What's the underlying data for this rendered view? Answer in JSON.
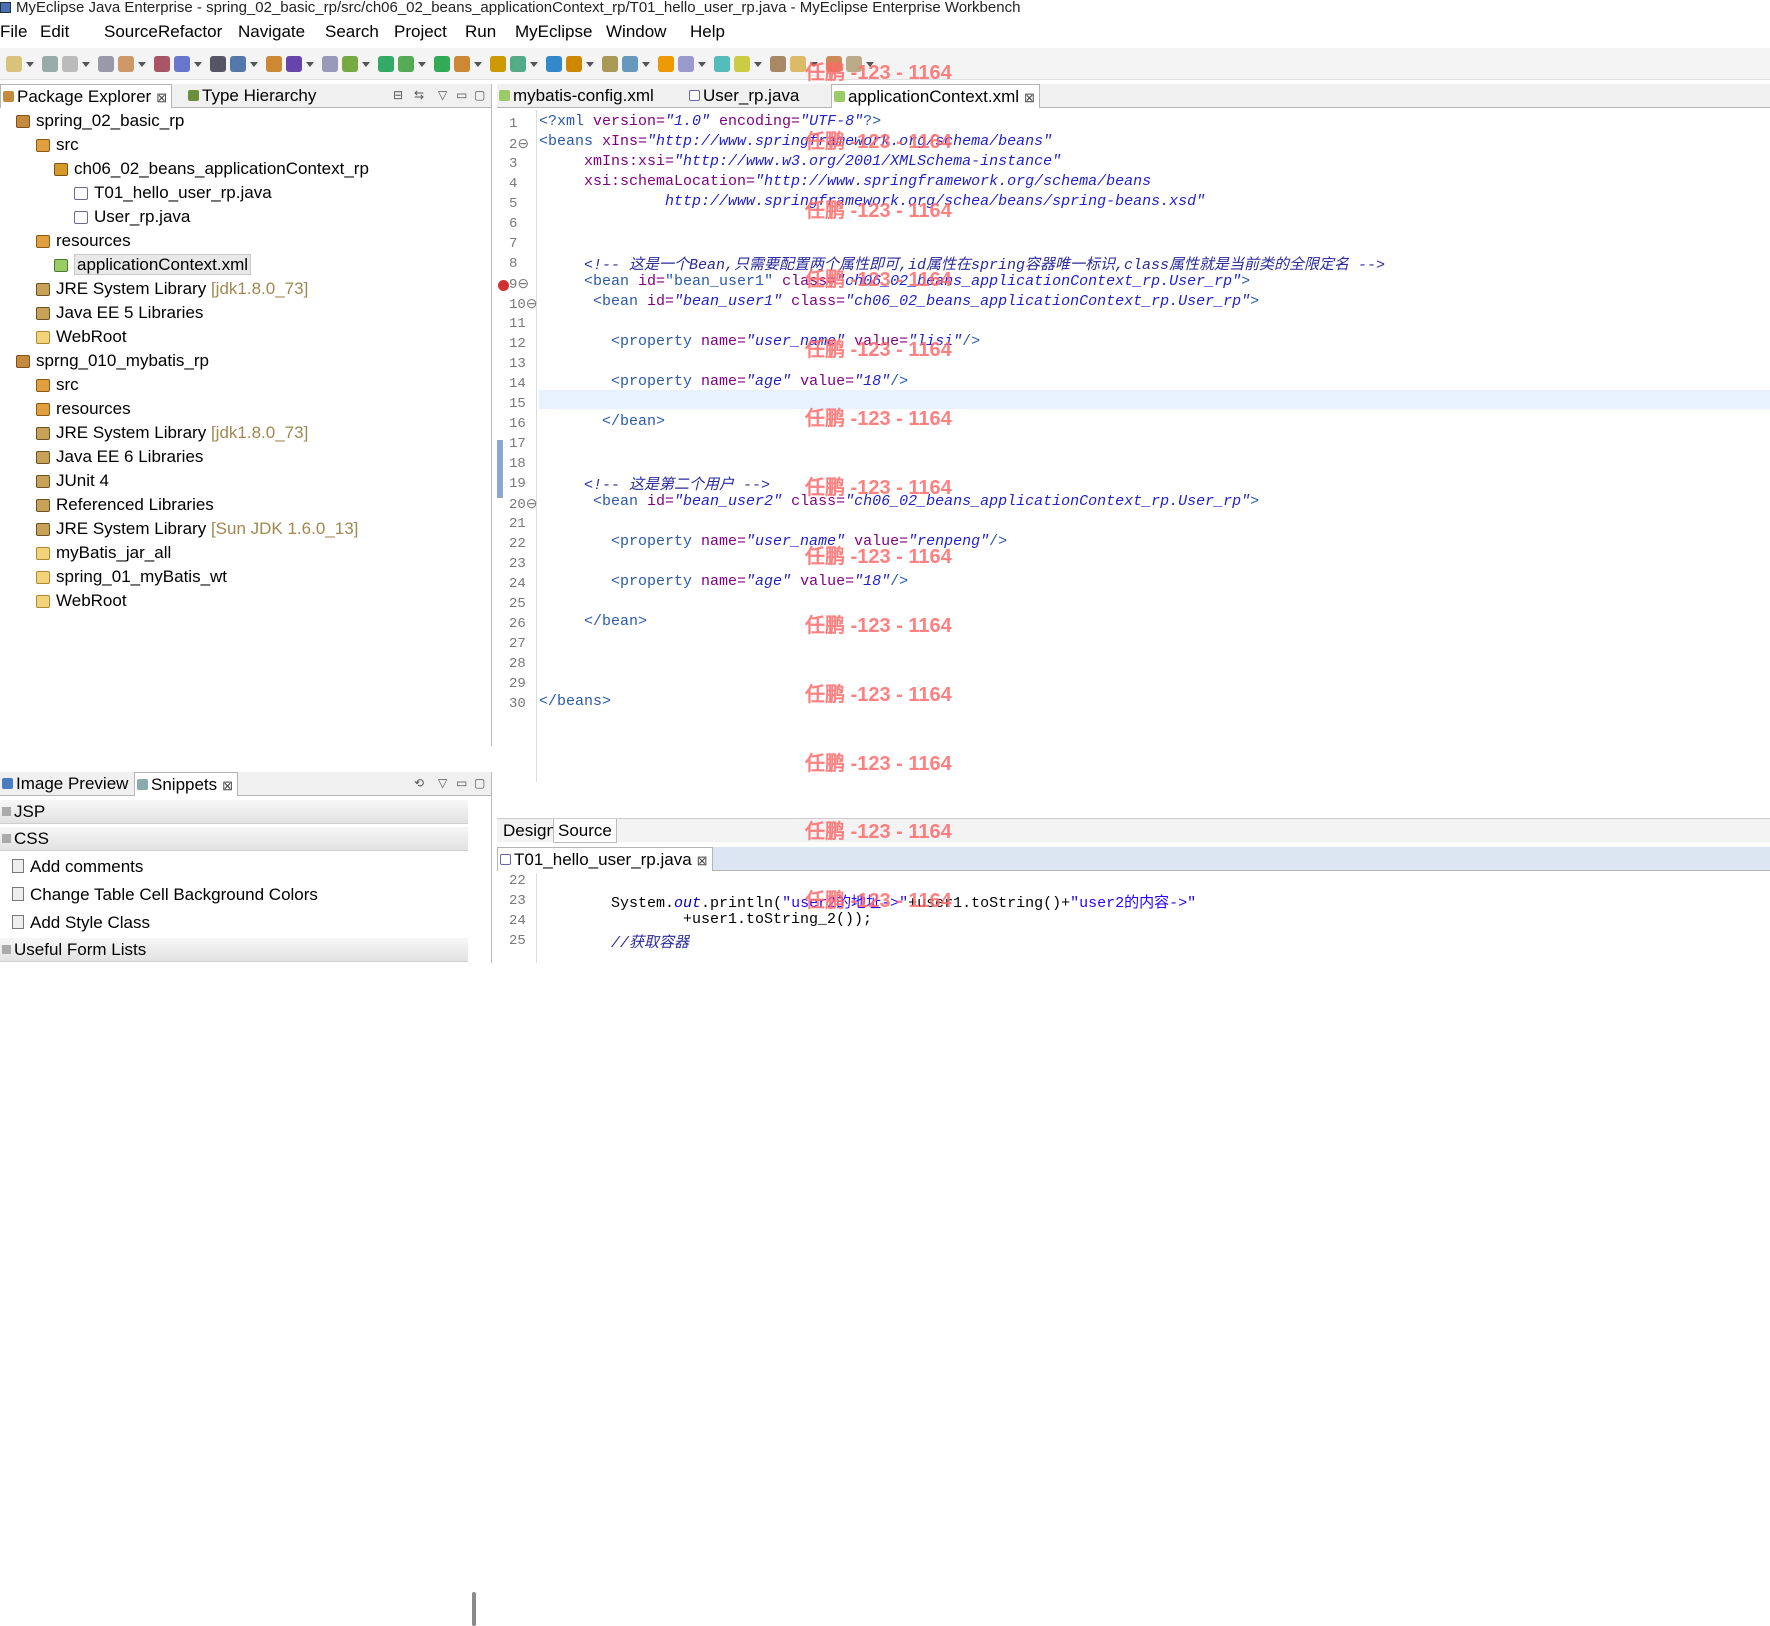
{
  "window": {
    "title": "MyEclipse Java Enterprise - spring_02_basic_rp/src/ch06_02_beans_applicationContext_rp/T01_hello_user_rp.java - MyEclipse Enterprise Workbench"
  },
  "menu": [
    "File",
    "Edit",
    "Source",
    "Refactor",
    "Navigate",
    "Search",
    "Project",
    "Run",
    "MyEclipse",
    "Window",
    "Help"
  ],
  "left_panel": {
    "tabs": [
      {
        "label": "Package Explorer"
      },
      {
        "label": "Type Hierarchy"
      }
    ],
    "close_glyph": "⊠",
    "tree": [
      {
        "label": "spring_02_basic_rp",
        "icon": "project-icon"
      },
      {
        "label": "src",
        "icon": "source-folder-icon"
      },
      {
        "label": "ch06_02_beans_applicationContext_rp",
        "icon": "package-icon"
      },
      {
        "label": "T01_hello_user_rp.java",
        "icon": "java-file-icon"
      },
      {
        "label": "User_rp.java",
        "icon": "java-file-icon"
      },
      {
        "label": "resources",
        "icon": "source-folder-icon"
      },
      {
        "label": "applicationContext.xml",
        "icon": "xml-file-icon"
      },
      {
        "label": "JRE System Library",
        "extra": "[jdk1.8.0_73]",
        "icon": "library-icon"
      },
      {
        "label": "Java EE 5 Libraries",
        "icon": "library-icon"
      },
      {
        "label": "WebRoot",
        "icon": "folder-icon"
      },
      {
        "label": "sprng_010_mybatis_rp",
        "icon": "project-icon"
      },
      {
        "label": "src",
        "icon": "source-folder-icon"
      },
      {
        "label": "resources",
        "icon": "source-folder-icon"
      },
      {
        "label": "JRE System Library",
        "extra": "[jdk1.8.0_73]",
        "icon": "library-icon"
      },
      {
        "label": "Java EE 6 Libraries",
        "icon": "library-icon"
      },
      {
        "label": "JUnit 4",
        "icon": "library-icon"
      },
      {
        "label": "Referenced Libraries",
        "icon": "library-icon"
      },
      {
        "label": "JRE System Library",
        "extra": "[Sun JDK 1.6.0_13]",
        "icon": "library-icon"
      },
      {
        "label": "myBatis_jar_all",
        "icon": "folder-icon"
      },
      {
        "label": "spring_01_myBatis_wt",
        "icon": "folder-icon"
      },
      {
        "label": "WebRoot",
        "icon": "folder-icon"
      }
    ]
  },
  "snippets_panel": {
    "tabs": [
      {
        "label": "Image Preview"
      },
      {
        "label": "Snippets"
      }
    ],
    "categories": [
      "JSP",
      "CSS",
      "Useful Form Lists"
    ],
    "items": [
      "Add comments",
      "Change Table Cell Background Colors",
      "Add Style Class"
    ]
  },
  "editor": {
    "tabs": [
      {
        "label": "mybatis-config.xml"
      },
      {
        "label": "User_rp.java"
      },
      {
        "label": "applicationContext.xml"
      }
    ],
    "line_numbers": [
      "1",
      "2⊖",
      "3",
      "4",
      "5",
      "6",
      "7",
      "8",
      "9⊖",
      "10⊖",
      "11",
      "12",
      "13",
      "14",
      "15",
      "16",
      "17",
      "18",
      "19",
      "20⊖",
      "21",
      "22",
      "23",
      "24",
      "25",
      "26",
      "27",
      "28",
      "29",
      "30"
    ],
    "lines": [
      [
        {
          "t": "<?xml ",
          "c": "tag"
        },
        {
          "t": "version=",
          "c": "attr"
        },
        {
          "t": "\"1.0\"",
          "c": "val"
        },
        {
          "t": " encoding=",
          "c": "attr"
        },
        {
          "t": "\"UTF-8\"",
          "c": "val"
        },
        {
          "t": "?>",
          "c": "tag"
        }
      ],
      [
        {
          "t": "<beans ",
          "c": "tag"
        },
        {
          "t": "xIns=",
          "c": "attr"
        },
        {
          "t": "\"http://www.springframework.org/schema/beans\"",
          "c": "val"
        }
      ],
      [
        {
          "t": "     xmIns:xsi=",
          "c": "attr"
        },
        {
          "t": "\"http://www.w3.org/2001/XMLSchema-instance\"",
          "c": "val"
        }
      ],
      [
        {
          "t": "     xsi:schemaLocation=",
          "c": "attr"
        },
        {
          "t": "\"http://www.springframework.org/schema/beans",
          "c": "val"
        }
      ],
      [
        {
          "t": "              http://www.springframework.org/schea/beans/spring-beans.xsd\"",
          "c": "val"
        }
      ],
      [],
      [],
      [
        {
          "t": "     <!-- 这是一个Bean,只需要配置两个属性即可,id属性在spring容器唯一标识,class属性就是当前类的全限定名 -->",
          "c": "cmt"
        }
      ],
      [
        {
          "t": "     <bean ",
          "c": "tag"
        },
        {
          "t": "id=",
          "c": "attr"
        },
        {
          "t": "\"bean_user1\"",
          "c": "tag"
        },
        {
          "t": " class=",
          "c": "attr"
        },
        {
          "t": "\"ch06_02_beans_applicationContext_rp.User_rp\"",
          "c": "val"
        },
        {
          "t": ">",
          "c": "tag"
        }
      ],
      [
        {
          "t": "      <bean ",
          "c": "tag"
        },
        {
          "t": "id=",
          "c": "attr"
        },
        {
          "t": "\"bean_user1\"",
          "c": "val"
        },
        {
          "t": " class=",
          "c": "attr"
        },
        {
          "t": "\"ch06_02_beans_applicationContext_rp.User_rp\"",
          "c": "val"
        },
        {
          "t": ">",
          "c": "tag"
        }
      ],
      [],
      [
        {
          "t": "        <property ",
          "c": "tag"
        },
        {
          "t": "name=",
          "c": "attr"
        },
        {
          "t": "\"user_name\"",
          "c": "val"
        },
        {
          "t": " value=",
          "c": "attr"
        },
        {
          "t": "\"lisi\"",
          "c": "val"
        },
        {
          "t": "/>",
          "c": "tag"
        }
      ],
      [],
      [
        {
          "t": "        <property ",
          "c": "tag"
        },
        {
          "t": "name=",
          "c": "attr"
        },
        {
          "t": "\"age\"",
          "c": "val"
        },
        {
          "t": " value=",
          "c": "attr"
        },
        {
          "t": "\"18\"",
          "c": "val"
        },
        {
          "t": "/>",
          "c": "tag"
        }
      ],
      [],
      [
        {
          "t": "       </bean>",
          "c": "tag"
        }
      ],
      [],
      [],
      [
        {
          "t": "     <!-- 这是第二个用户 -->",
          "c": "cmt"
        }
      ],
      [
        {
          "t": "      <bean ",
          "c": "tag"
        },
        {
          "t": "id=",
          "c": "attr"
        },
        {
          "t": "\"bean_user2\"",
          "c": "val"
        },
        {
          "t": " class=",
          "c": "attr"
        },
        {
          "t": "\"ch06_02_beans_applicationContext_rp.User_rp\"",
          "c": "val"
        },
        {
          "t": ">",
          "c": "tag"
        }
      ],
      [],
      [
        {
          "t": "        <property ",
          "c": "tag"
        },
        {
          "t": "name=",
          "c": "attr"
        },
        {
          "t": "\"user_name\"",
          "c": "val"
        },
        {
          "t": " value=",
          "c": "attr"
        },
        {
          "t": "\"renpeng\"",
          "c": "val"
        },
        {
          "t": "/>",
          "c": "tag"
        }
      ],
      [],
      [
        {
          "t": "        <property ",
          "c": "tag"
        },
        {
          "t": "name=",
          "c": "attr"
        },
        {
          "t": "\"age\"",
          "c": "val"
        },
        {
          "t": " value=",
          "c": "attr"
        },
        {
          "t": "\"18\"",
          "c": "val"
        },
        {
          "t": "/>",
          "c": "tag"
        }
      ],
      [],
      [
        {
          "t": "     </bean>",
          "c": "tag"
        }
      ],
      [],
      [],
      [],
      [
        {
          "t": "</beans>",
          "c": "tag"
        }
      ]
    ],
    "bottom_tabs": {
      "design": "Design",
      "source": "Source"
    }
  },
  "java_editor": {
    "tab": "T01_hello_user_rp.java",
    "line_numbers": [
      "22",
      "23",
      "24",
      "25"
    ],
    "lines": [
      [],
      [
        {
          "t": "        System.",
          "c": "p"
        },
        {
          "t": "out",
          "c": "fld"
        },
        {
          "t": ".println(",
          "c": "p"
        },
        {
          "t": "\"user2的地址->\"",
          "c": "str"
        },
        {
          "t": "+user1.toString()+",
          "c": "p"
        },
        {
          "t": "\"user2的内容->\"",
          "c": "str"
        }
      ],
      [
        {
          "t": "                +user1.toString_2());",
          "c": "p"
        }
      ],
      [
        {
          "t": "        //获取容器",
          "c": "cmt"
        }
      ]
    ]
  },
  "watermark": {
    "text": "任鹏 -123 - 1164"
  }
}
